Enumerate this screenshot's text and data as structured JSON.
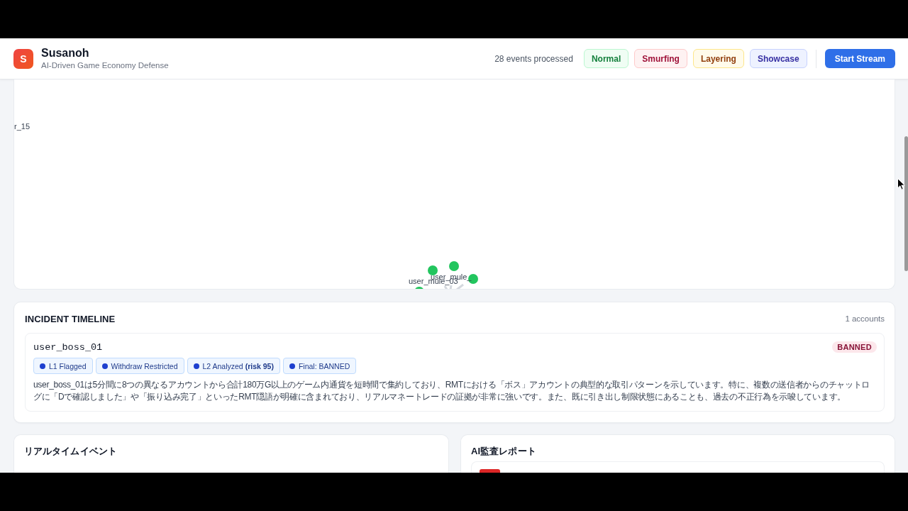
{
  "header": {
    "logo": "S",
    "title": "Susanoh",
    "subtitle": "AI-Driven Game Economy Defense",
    "events_processed": "28 events processed",
    "scenarios": [
      {
        "label": "Normal",
        "kind": "normal"
      },
      {
        "label": "Smurfing",
        "kind": "smurfing"
      },
      {
        "label": "Layering",
        "kind": "layering"
      },
      {
        "label": "Showcase",
        "kind": "showcase"
      }
    ],
    "start_button": "Start Stream"
  },
  "graph": {
    "node_labels": [
      "r_15",
      "user_mule_03",
      "user_mule_"
    ]
  },
  "incident_timeline": {
    "title": "INCIDENT TIMELINE",
    "count": "1 accounts",
    "incidents": [
      {
        "account": "user_boss_01",
        "status": "BANNED",
        "steps": [
          "L1 Flagged",
          "Withdraw Restricted",
          "L2 Analyzed **(risk 95)**",
          "Final: BANNED"
        ],
        "summary": "user_boss_01は5分間に8つの異なるアカウントから合計180万G以上のゲーム内通貨を短時間で集約しており、RMTにおける「ボス」アカウントの典型的な取引パターンを示しています。特に、複数の送信者からのチャットログに「Dで確認しました」や「振り込み完了」といったRMT隠語が明確に含まれており、リアルマネートレードの証拠が非常に強いです。また、既に引き出し制限状態にあることも、過去の不正行為を示唆しています。"
      }
    ]
  },
  "realtime_events": {
    "title": "リアルタイムイベント"
  },
  "ai_audit_report": {
    "title": "AI監査レポート"
  }
}
